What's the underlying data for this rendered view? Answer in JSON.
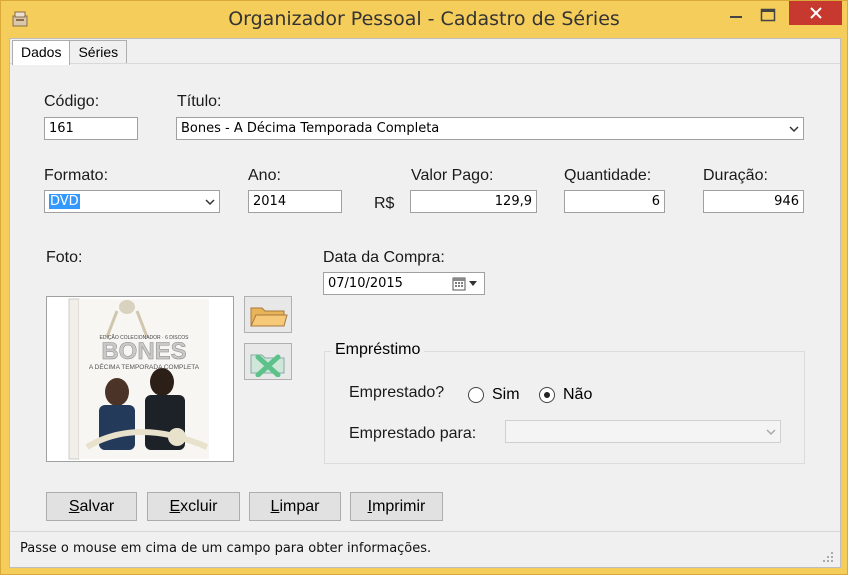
{
  "window": {
    "title": "Organizador Pessoal - Cadastro de Séries",
    "minimize_glyph": "—",
    "maximize_glyph": "☐",
    "close_glyph": "✕"
  },
  "tabs": [
    {
      "label": "Dados",
      "active": true
    },
    {
      "label": "Séries",
      "active": false
    }
  ],
  "form": {
    "codigo_label": "Código:",
    "codigo_value": "161",
    "titulo_label": "Título:",
    "titulo_value": "Bones - A Décima Temporada Completa",
    "formato_label": "Formato:",
    "formato_value": "DVD",
    "ano_label": "Ano:",
    "ano_value": "2014",
    "valor_label": "Valor Pago:",
    "currency": "R$",
    "valor_value": "129,9",
    "quantidade_label": "Quantidade:",
    "quantidade_value": "6",
    "duracao_label": "Duração:",
    "duracao_value": "946",
    "foto_label": "Foto:",
    "data_compra_label": "Data da Compra:",
    "data_compra_value": "07/10/2015"
  },
  "cover": {
    "brand": "BONES",
    "subtitle": "A DÉCIMA TEMPORADA COMPLETA",
    "tagline": "EDIÇÃO COLECIONADOR · 6 DISCOS"
  },
  "emprestimo": {
    "group_title": "Empréstimo",
    "emprestado_label": "Emprestado?",
    "sim_label": "Sim",
    "nao_label": "Não",
    "selected": "Não",
    "para_label": "Emprestado para:",
    "para_value": ""
  },
  "buttons": {
    "salvar_first": "S",
    "salvar_rest": "alvar",
    "excluir_first": "E",
    "excluir_rest": "xcluir",
    "limpar_first": "L",
    "limpar_rest": "impar",
    "imprimir_first": "I",
    "imprimir_rest": "mprimir"
  },
  "status": {
    "text": "Passe o mouse em cima de um campo para obter informações."
  },
  "colors": {
    "titlebar": "#f5cd5b",
    "close_button": "#c7392f",
    "selection": "#3399ff"
  }
}
